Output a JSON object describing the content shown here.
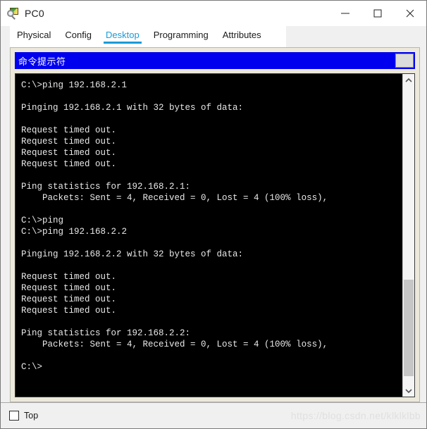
{
  "window": {
    "title": "PC0",
    "icon": "packet-tracer-device-icon",
    "controls": {
      "minimize": "—",
      "maximize": "□",
      "close": "✕"
    }
  },
  "tabs": [
    {
      "label": "Physical",
      "active": false
    },
    {
      "label": "Config",
      "active": false
    },
    {
      "label": "Desktop",
      "active": true
    },
    {
      "label": "Programming",
      "active": false
    },
    {
      "label": "Attributes",
      "active": false
    }
  ],
  "command_prompt": {
    "caption": "命令提示符",
    "caption_button_label": "",
    "lines": [
      "C:\\>ping 192.168.2.1",
      "",
      "Pinging 192.168.2.1 with 32 bytes of data:",
      "",
      "Request timed out.",
      "Request timed out.",
      "Request timed out.",
      "Request timed out.",
      "",
      "Ping statistics for 192.168.2.1:",
      "    Packets: Sent = 4, Received = 0, Lost = 4 (100% loss),",
      "",
      "C:\\>ping",
      "C:\\>ping 192.168.2.2",
      "",
      "Pinging 192.168.2.2 with 32 bytes of data:",
      "",
      "Request timed out.",
      "Request timed out.",
      "Request timed out.",
      "Request timed out.",
      "",
      "Ping statistics for 192.168.2.2:",
      "    Packets: Sent = 4, Received = 0, Lost = 4 (100% loss),",
      "",
      "C:\\>"
    ]
  },
  "scrollbar": {
    "up_arrow": "chevron-up",
    "down_arrow": "chevron-down"
  },
  "bottom": {
    "checkbox_label": "Top",
    "checkbox_checked": false,
    "watermark": "https://blog.csdn.net/klklklbb"
  },
  "colors": {
    "accent": "#1a9bd7",
    "caption_blue": "#0000ee",
    "panel_beige": "#ece9dc",
    "terminal_bg": "#000000",
    "terminal_fg": "#e8e8e8"
  }
}
